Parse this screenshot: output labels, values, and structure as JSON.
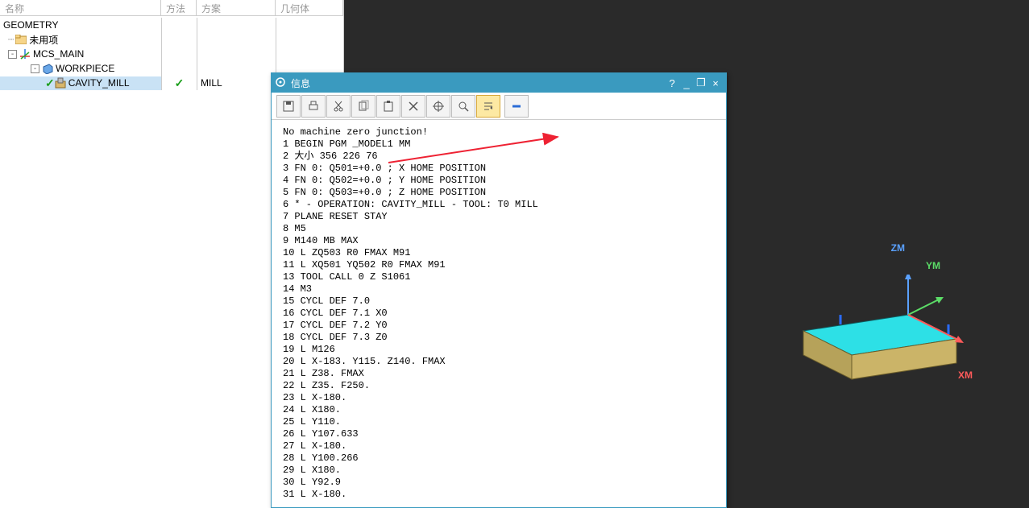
{
  "tree_header": {
    "c0": "名称",
    "c1": "方法",
    "c2": "方案",
    "c3": "几何体"
  },
  "tree": {
    "root": "GEOMETRY",
    "unused": "未用项",
    "mcs": "MCS_MAIN",
    "wp": "WORKPIECE",
    "cav": "CAVITY_MILL",
    "cav_method": "MILL"
  },
  "info": {
    "title": "信息",
    "lines": [
      "No machine zero junction!",
      "1 BEGIN PGM _MODEL1 MM",
      "2 大小 356 226 76",
      "3 FN 0: Q501=+0.0 ; X HOME POSITION",
      "4 FN 0: Q502=+0.0 ; Y HOME POSITION",
      "5 FN 0: Q503=+0.0 ; Z HOME POSITION",
      "6 * - OPERATION: CAVITY_MILL - TOOL: T0 MILL",
      "7 PLANE RESET STAY",
      "8 M5",
      "9 M140 MB MAX",
      "10 L ZQ503 R0 FMAX M91",
      "11 L XQ501 YQ502 R0 FMAX M91",
      "13 TOOL CALL 0 Z S1061",
      "14 M3",
      "15 CYCL DEF 7.0",
      "16 CYCL DEF 7.1 X0",
      "17 CYCL DEF 7.2 Y0",
      "18 CYCL DEF 7.3 Z0",
      "19 L M126",
      "20 L X-183. Y115. Z140. FMAX",
      "21 L Z38. FMAX",
      "22 L Z35. F250.",
      "23 L X-180.",
      "24 L X180.",
      "25 L Y110.",
      "26 L Y107.633",
      "27 L X-180.",
      "28 L Y100.266",
      "29 L X180.",
      "30 L Y92.9",
      "31 L X-180."
    ]
  },
  "axes": {
    "x": "XM",
    "y": "YM",
    "z": "ZM"
  },
  "icons": {
    "gear": "gear-icon",
    "help": "?",
    "min": "_",
    "restore": "❐",
    "close": "×",
    "save": "save-icon",
    "print": "print-icon",
    "cut": "cut-icon",
    "copy": "copy-icon",
    "paste": "paste-icon",
    "delete": "delete-icon",
    "target": "target-icon",
    "find": "find-icon",
    "wrap": "wrap-icon",
    "minus": "minus-icon"
  }
}
